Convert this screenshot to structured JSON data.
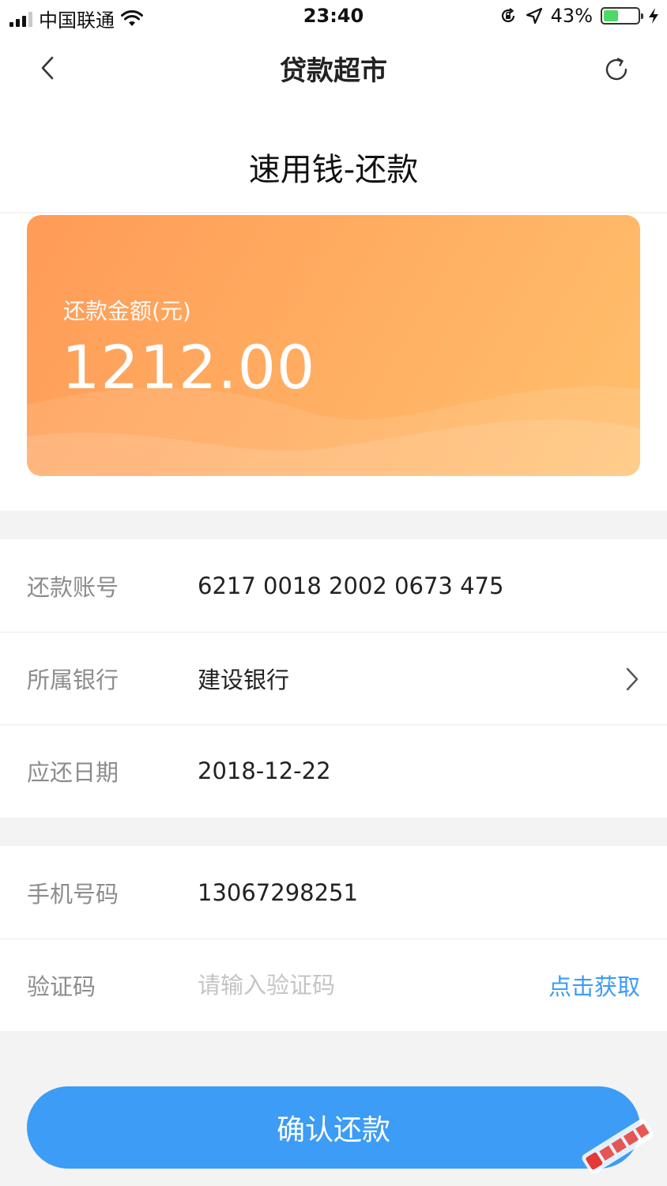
{
  "status_bar": {
    "carrier": "中国联通",
    "time": "23:40",
    "battery_percent": "43%",
    "battery_level": 0.43,
    "battery_color": "#4cd964"
  },
  "nav": {
    "title": "贷款超市",
    "back_icon": "chevron-left-icon",
    "refresh_icon": "refresh-icon"
  },
  "header": {
    "title": "速用钱-还款"
  },
  "amount_card": {
    "label": "还款金额(元)",
    "value": "1212.00",
    "gradient_start": "#ff9b57",
    "gradient_end": "#ffc06c"
  },
  "account_info": {
    "rows": [
      {
        "label": "还款账号",
        "value": "6217 0018 2002 0673 475"
      },
      {
        "label": "所属银行",
        "value": "建设银行"
      },
      {
        "label": "应还日期",
        "value": "2018-12-22"
      }
    ]
  },
  "verify": {
    "phone_label": "手机号码",
    "phone_value": "13067298251",
    "code_label": "验证码",
    "code_placeholder": "请输入验证码",
    "code_value": "",
    "get_code_label": "点击获取"
  },
  "confirm": {
    "label": "确认还款",
    "color": "#3c9cf6"
  },
  "watermark": {
    "text": "卡农社区"
  }
}
